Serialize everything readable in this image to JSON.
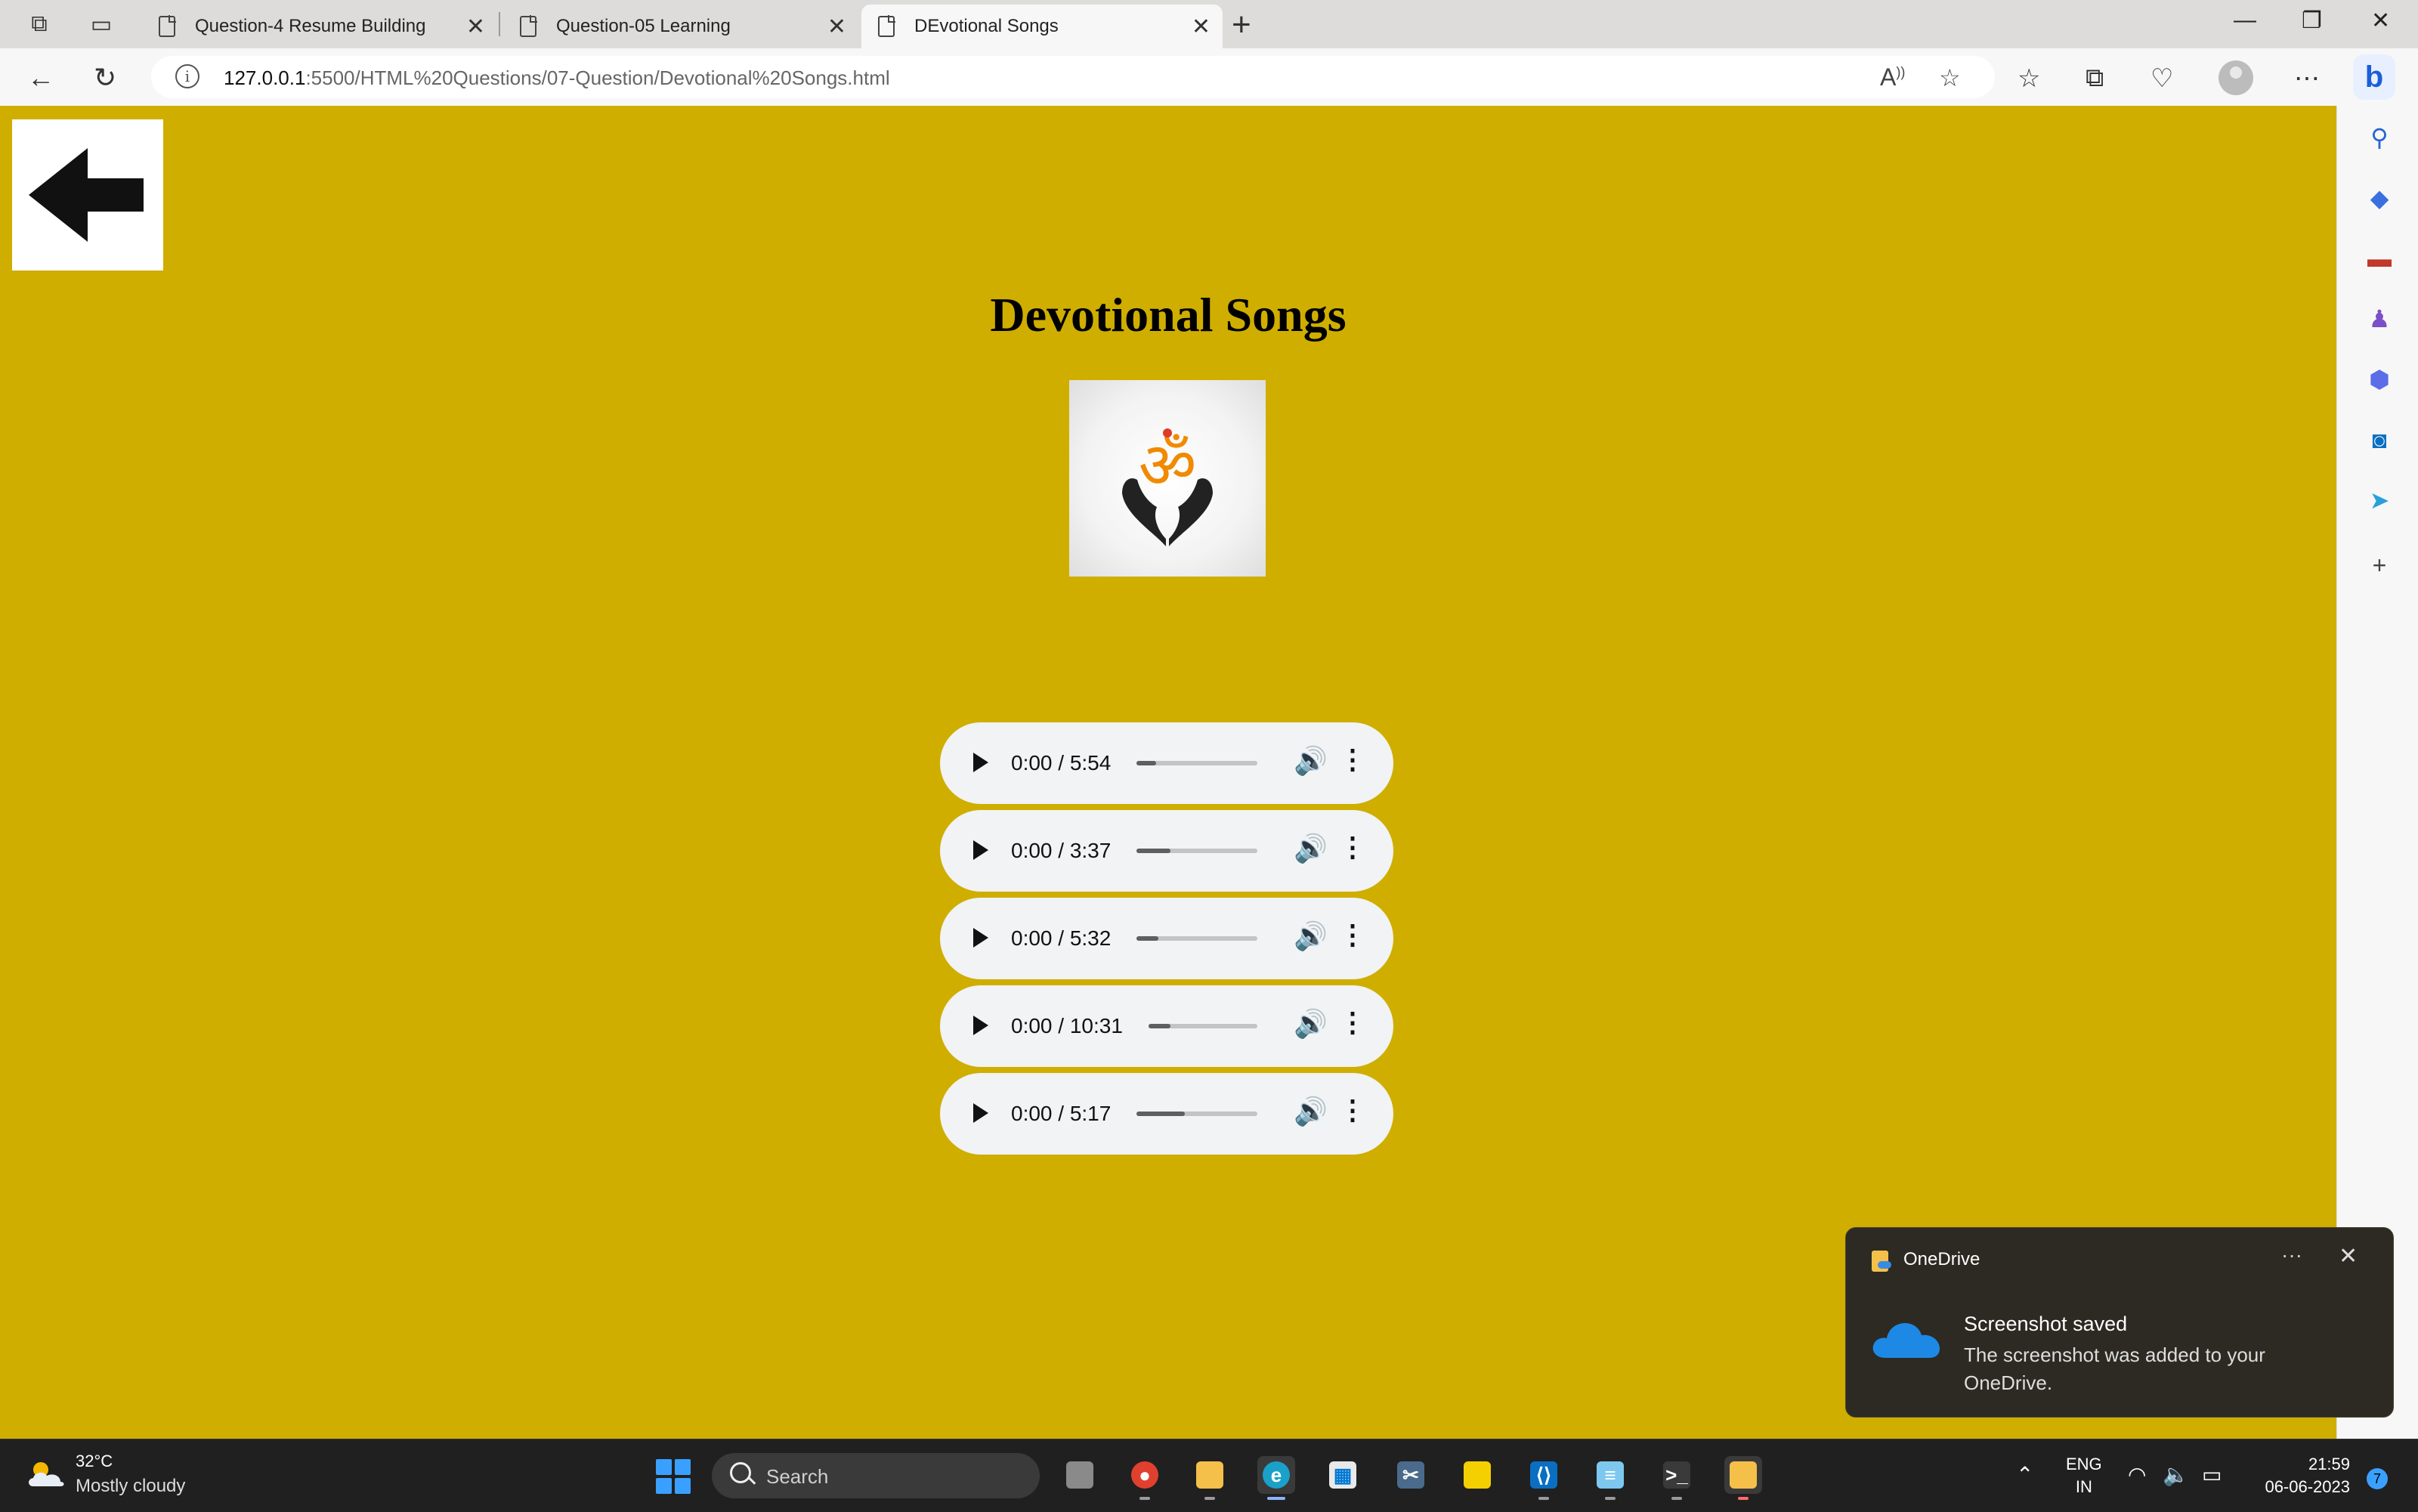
{
  "browser": {
    "tabs": [
      {
        "title": "Question-4 Resume Building"
      },
      {
        "title": "Question-05 Learning"
      },
      {
        "title": "DEvotional Songs",
        "active": true
      }
    ],
    "url_host": "127.0.0.1",
    "url_rest": ":5500/HTML%20Questions/07-Question/Devotional%20Songs.html"
  },
  "page": {
    "background": "#cfae00",
    "title": "Devotional Songs",
    "logo_symbol": "ॐ",
    "players": [
      {
        "time": "0:00 / 5:54",
        "progress": 0.16
      },
      {
        "time": "0:00 / 3:37",
        "progress": 0.28
      },
      {
        "time": "0:00 / 5:32",
        "progress": 0.18
      },
      {
        "time": "0:00 / 10:31",
        "progress": 0.2
      },
      {
        "time": "0:00 / 5:17",
        "progress": 0.4
      }
    ]
  },
  "toast": {
    "app": "OneDrive",
    "title": "Screenshot saved",
    "body": "The screenshot was added to your OneDrive."
  },
  "taskbar": {
    "temperature": "32°C",
    "condition": "Mostly cloudy",
    "search_label": "Search",
    "lang_line1": "ENG",
    "lang_line2": "IN",
    "time": "21:59",
    "date": "06-06-2023",
    "notification_count": "7"
  }
}
